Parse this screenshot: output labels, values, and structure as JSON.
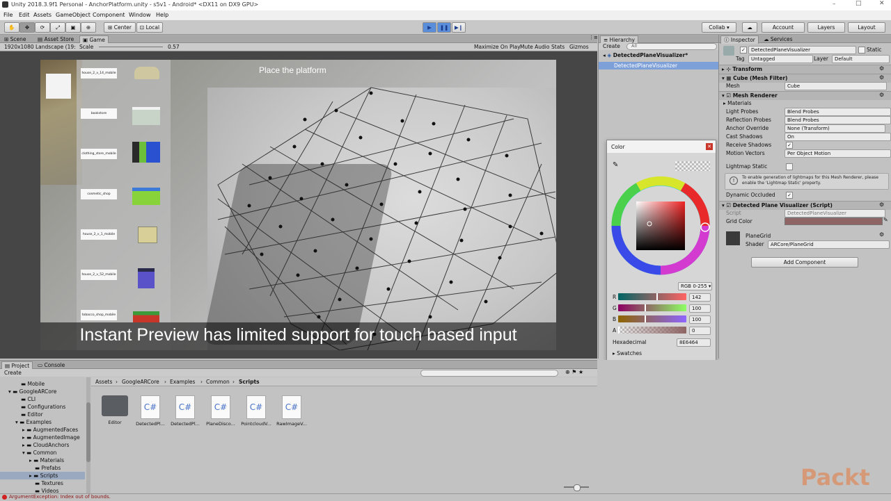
{
  "window": {
    "title": "Unity 2018.3.9f1 Personal - AnchorPlatform.unity - s5v1 - Android* <DX11 on DX9 GPU>"
  },
  "menu": [
    "File",
    "Edit",
    "Assets",
    "GameObject",
    "Component",
    "Window",
    "Help"
  ],
  "toolbar": {
    "center": "Center",
    "local": "Local",
    "collab": "Collab ▾",
    "account": "Account",
    "layers": "Layers",
    "layout": "Layout"
  },
  "scene_tabs": {
    "scene": "Scene",
    "asset_store": "Asset Store",
    "game": "Game"
  },
  "game_bar": {
    "resolution": "1920x1080 Landscape (19:",
    "scale_label": "Scale",
    "scale_value": "0.57",
    "maximize": "Maximize On Play",
    "mute": "Mute Audio",
    "stats": "Stats",
    "gizmos": "Gizmos"
  },
  "game_view": {
    "prompt": "Place the platform",
    "caption": "Instant Preview has limited support for touch based input",
    "items": [
      "house_2_v_14_mobile",
      "bookstore",
      "clothing_store_mobile",
      "cosmetic_shop",
      "house_2_v_1_mobile",
      "house_2_v_52_mobile",
      "tobacco_shop_mobile"
    ],
    "item_colors": [
      "#cfc7a0",
      "#c9d4c9",
      "#2a52d0",
      "#88d23a",
      "#d8cf98",
      "#5a52c8",
      "#3c9a3a"
    ]
  },
  "hierarchy": {
    "tab": "Hierarchy",
    "create": "Create",
    "search_placeholder": "All",
    "scene": "DetectedPlaneVisualizer*",
    "object": "DetectedPlaneVisualizer"
  },
  "color_picker": {
    "title": "Color",
    "mode": "RGB 0-255 ▾",
    "channels": [
      {
        "label": "R",
        "value": "142"
      },
      {
        "label": "G",
        "value": "100"
      },
      {
        "label": "B",
        "value": "100"
      },
      {
        "label": "A",
        "value": "0"
      }
    ],
    "hex_label": "Hexadecimal",
    "hex_value": "8E6464",
    "swatches": "Swatches",
    "selected_color": "#8E6464"
  },
  "inspector": {
    "tab": "Inspector",
    "services": "Services",
    "object_name": "DetectedPlaneVisualizer",
    "static_label": "Static",
    "tag_label": "Tag",
    "tag_value": "Untagged",
    "layer_label": "Layer",
    "layer_value": "Default",
    "transform": "Transform",
    "mesh_filter": {
      "title": "Cube (Mesh Filter)",
      "mesh_label": "Mesh",
      "mesh_value": "Cube"
    },
    "mesh_renderer": {
      "title": "Mesh Renderer",
      "materials": "Materials",
      "rows": [
        {
          "label": "Light Probes",
          "value": "Blend Probes"
        },
        {
          "label": "Reflection Probes",
          "value": "Blend Probes"
        },
        {
          "label": "Anchor Override",
          "value": "None (Transform)"
        },
        {
          "label": "Cast Shadows",
          "value": "On"
        }
      ],
      "receive_shadows": "Receive Shadows",
      "motion_vectors_label": "Motion Vectors",
      "motion_vectors_value": "Per Object Motion",
      "lightmap_static": "Lightmap Static",
      "info": "To enable generation of lightmaps for this Mesh Renderer, please enable the 'Lightmap Static' property.",
      "dynamic_occluded": "Dynamic Occluded"
    },
    "script_component": {
      "title": "Detected Plane Visualizer (Script)",
      "script_label": "Script",
      "script_value": "DetectedPlaneVisualizer",
      "grid_color_label": "Grid Color",
      "grid_color": "#8E6464"
    },
    "material": {
      "name": "PlaneGrid",
      "shader_label": "Shader",
      "shader_value": "ARCore/PlaneGrid"
    },
    "add_component": "Add Component"
  },
  "project": {
    "tab": "Project",
    "console": "Console",
    "create": "Create",
    "tree": [
      "Mobile",
      "GoogleARCore",
      "CLI",
      "Configurations",
      "Editor",
      "Examples",
      "AugmentedFaces",
      "AugmentedImage",
      "CloudAnchors",
      "Common",
      "Materials",
      "Prefabs",
      "Scripts",
      "Textures",
      "Videos"
    ],
    "breadcrumb": [
      "Assets",
      "GoogleARCore",
      "Examples",
      "Common",
      "Scripts"
    ],
    "assets": [
      "Editor",
      "DetectedPl...",
      "DetectedPl...",
      "PlaneDisco...",
      "PointcloudV...",
      "RawImageV..."
    ]
  },
  "status": {
    "error": "ArgumentException: Index out of bounds."
  },
  "watermark": "Packt"
}
